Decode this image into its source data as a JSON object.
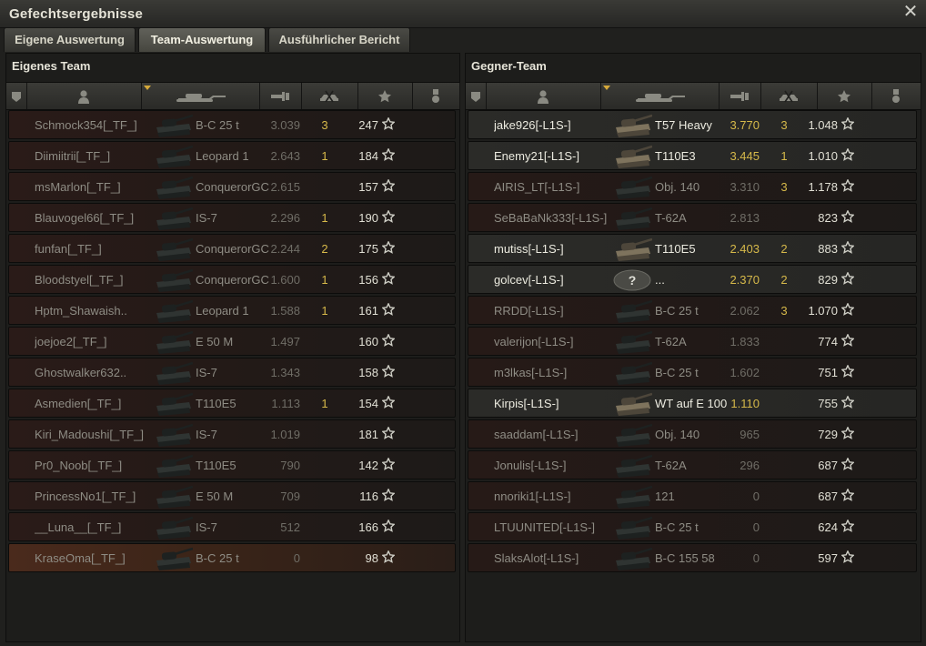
{
  "window": {
    "title": "Gefechtsergebnisse"
  },
  "tabs": [
    {
      "label": "Eigene Auswertung",
      "active": false
    },
    {
      "label": "Team-Auswertung",
      "active": true
    },
    {
      "label": "Ausführlicher Bericht",
      "active": false
    }
  ],
  "own_team": {
    "title": "Eigenes Team",
    "rows": [
      {
        "player": "Schmock354[_TF_]",
        "tank": "B-C 25 t",
        "damage": "3.039",
        "kills": "3",
        "xp": "247",
        "alive": false,
        "self": false
      },
      {
        "player": "Diimiitrii[_TF_]",
        "tank": "Leopard 1",
        "damage": "2.643",
        "kills": "1",
        "xp": "184",
        "alive": false,
        "self": false
      },
      {
        "player": "msMarlon[_TF_]",
        "tank": "ConquerorGC",
        "damage": "2.615",
        "kills": "",
        "xp": "157",
        "alive": false,
        "self": false
      },
      {
        "player": "Blauvogel66[_TF_]",
        "tank": "IS-7",
        "damage": "2.296",
        "kills": "1",
        "xp": "190",
        "alive": false,
        "self": false
      },
      {
        "player": "funfan[_TF_]",
        "tank": "ConquerorGC",
        "damage": "2.244",
        "kills": "2",
        "xp": "175",
        "alive": false,
        "self": false
      },
      {
        "player": "Bloodstyel[_TF_]",
        "tank": "ConquerorGC",
        "damage": "1.600",
        "kills": "1",
        "xp": "156",
        "alive": false,
        "self": false
      },
      {
        "player": "Hptm_Shawaish..",
        "tank": "Leopard 1",
        "damage": "1.588",
        "kills": "1",
        "xp": "161",
        "alive": false,
        "self": false
      },
      {
        "player": "joejoe2[_TF_]",
        "tank": "E 50 M",
        "damage": "1.497",
        "kills": "",
        "xp": "160",
        "alive": false,
        "self": false
      },
      {
        "player": "Ghostwalker632..",
        "tank": "IS-7",
        "damage": "1.343",
        "kills": "",
        "xp": "158",
        "alive": false,
        "self": false
      },
      {
        "player": "Asmedien[_TF_]",
        "tank": "T110E5",
        "damage": "1.113",
        "kills": "1",
        "xp": "154",
        "alive": false,
        "self": false
      },
      {
        "player": "Kiri_Madoushi[_TF_]",
        "tank": "IS-7",
        "damage": "1.019",
        "kills": "",
        "xp": "181",
        "alive": false,
        "self": false
      },
      {
        "player": "Pr0_Noob[_TF_]",
        "tank": "T110E5",
        "damage": "790",
        "kills": "",
        "xp": "142",
        "alive": false,
        "self": false
      },
      {
        "player": "PrincessNo1[_TF_]",
        "tank": "E 50 M",
        "damage": "709",
        "kills": "",
        "xp": "116",
        "alive": false,
        "self": false
      },
      {
        "player": "__Luna__[_TF_]",
        "tank": "IS-7",
        "damage": "512",
        "kills": "",
        "xp": "166",
        "alive": false,
        "self": false
      },
      {
        "player": "KraseOma[_TF_]",
        "tank": "B-C 25 t",
        "damage": "0",
        "kills": "",
        "xp": "98",
        "alive": false,
        "self": true
      }
    ]
  },
  "enemy_team": {
    "title": "Gegner-Team",
    "rows": [
      {
        "player": "jake926[-L1S-]",
        "tank": "T57 Heavy",
        "damage": "3.770",
        "kills": "3",
        "xp": "1.048",
        "alive": true,
        "self": false
      },
      {
        "player": "Enemy21[-L1S-]",
        "tank": "T110E3",
        "damage": "3.445",
        "kills": "1",
        "xp": "1.010",
        "alive": true,
        "self": false
      },
      {
        "player": "AIRIS_LT[-L1S-]",
        "tank": "Obj. 140",
        "damage": "3.310",
        "kills": "3",
        "xp": "1.178",
        "alive": false,
        "self": false
      },
      {
        "player": "SeBaBaNk333[-L1S-]",
        "tank": "T-62A",
        "damage": "2.813",
        "kills": "",
        "xp": "823",
        "alive": false,
        "self": false
      },
      {
        "player": "mutiss[-L1S-]",
        "tank": "T110E5",
        "damage": "2.403",
        "kills": "2",
        "xp": "883",
        "alive": true,
        "self": false
      },
      {
        "player": "golcev[-L1S-]",
        "tank": "...",
        "damage": "2.370",
        "kills": "2",
        "xp": "829",
        "alive": true,
        "self": false,
        "unknown": true
      },
      {
        "player": "RRDD[-L1S-]",
        "tank": "B-C 25 t",
        "damage": "2.062",
        "kills": "3",
        "xp": "1.070",
        "alive": false,
        "self": false
      },
      {
        "player": "valerijon[-L1S-]",
        "tank": "T-62A",
        "damage": "1.833",
        "kills": "",
        "xp": "774",
        "alive": false,
        "self": false
      },
      {
        "player": "m3lkas[-L1S-]",
        "tank": "B-C 25 t",
        "damage": "1.602",
        "kills": "",
        "xp": "751",
        "alive": false,
        "self": false
      },
      {
        "player": "Kirpis[-L1S-]",
        "tank": "WT auf E 100",
        "damage": "1.110",
        "kills": "",
        "xp": "755",
        "alive": true,
        "self": false
      },
      {
        "player": "saaddam[-L1S-]",
        "tank": "Obj. 140",
        "damage": "965",
        "kills": "",
        "xp": "729",
        "alive": false,
        "self": false
      },
      {
        "player": "Jonulis[-L1S-]",
        "tank": "T-62A",
        "damage": "296",
        "kills": "",
        "xp": "687",
        "alive": false,
        "self": false
      },
      {
        "player": "nnoriki1[-L1S-]",
        "tank": "121",
        "damage": "0",
        "kills": "",
        "xp": "687",
        "alive": false,
        "self": false
      },
      {
        "player": "LTUUNITED[-L1S-]",
        "tank": "B-C 25 t",
        "damage": "0",
        "kills": "",
        "xp": "624",
        "alive": false,
        "self": false
      },
      {
        "player": "SlaksAlot[-L1S-]",
        "tank": "B-C 155 58",
        "damage": "0",
        "kills": "",
        "xp": "597",
        "alive": false,
        "self": false
      }
    ]
  },
  "columns": [
    "squad-icon",
    "player-icon",
    "tank-icon",
    "damage-icon",
    "kills-icon",
    "xp-star-icon",
    "medal-icon"
  ],
  "colors": {
    "damage_alive": "#d6b94a",
    "kills": "#d6b94a",
    "text_alive": "#ecebe0",
    "text_dead": "#8e8c84",
    "self_row": "#4a2a1c"
  }
}
